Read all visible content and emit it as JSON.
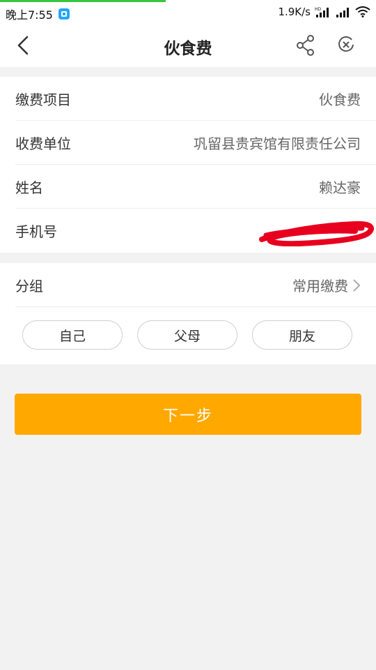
{
  "status_bar": {
    "time": "晚上7:55",
    "speed": "1.9K/s",
    "network_badge": "HD"
  },
  "header": {
    "title": "伙食费"
  },
  "details": [
    {
      "label": "缴费项目",
      "value": "伙食费"
    },
    {
      "label": "收费单位",
      "value": "巩留县贵宾馆有限责任公司"
    },
    {
      "label": "姓名",
      "value": "赖达豪"
    },
    {
      "label": "手机号",
      "value": ""
    }
  ],
  "group": {
    "label": "分组",
    "value": "常用缴费",
    "options": [
      "自己",
      "父母",
      "朋友"
    ]
  },
  "actions": {
    "next_label": "下一步"
  },
  "colors": {
    "accent": "#ffa800",
    "progress": "#39c53f",
    "redaction": "#e8001f"
  },
  "icons": [
    "back-arrow-icon",
    "share-icon",
    "close-circle-icon",
    "chevron-right-icon",
    "signal-icon",
    "wifi-icon"
  ]
}
